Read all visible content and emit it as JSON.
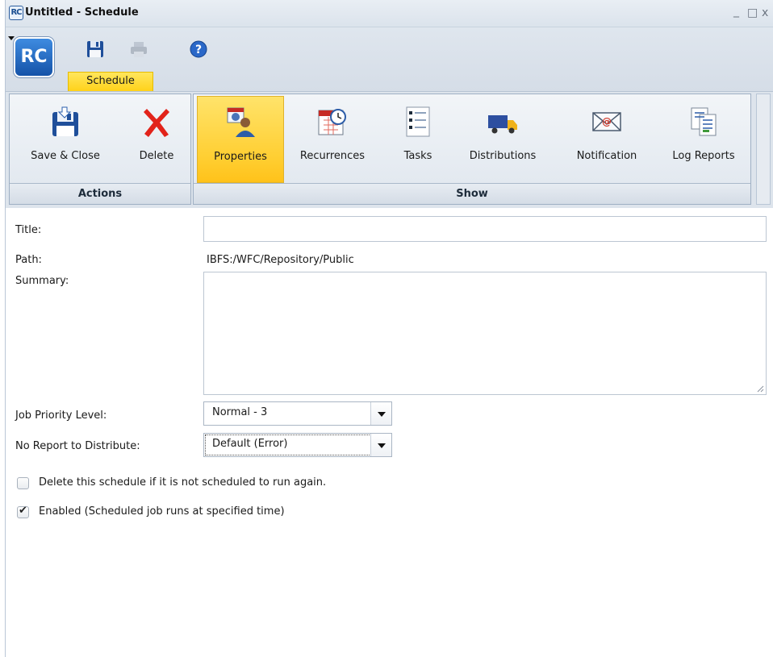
{
  "window": {
    "app_badge": "RC",
    "title": "Untitled - Schedule",
    "controls": {
      "minimize": "_",
      "maximize": "□",
      "close": "x"
    }
  },
  "quick_access": {
    "logo_text": "RC",
    "items": [
      {
        "name": "save",
        "icon": "floppy-disk-icon"
      },
      {
        "name": "print",
        "icon": "printer-icon",
        "disabled": true
      },
      {
        "name": "customize",
        "icon": "dropdown-arrow-icon"
      },
      {
        "name": "help",
        "icon": "help-icon"
      }
    ],
    "active_tab": "Schedule"
  },
  "ribbon": {
    "groups": [
      {
        "label": "Actions",
        "buttons": [
          {
            "label": "Save & Close",
            "icon": "save-close-icon"
          },
          {
            "label": "Delete",
            "icon": "delete-x-icon"
          }
        ]
      },
      {
        "label": "Show",
        "buttons": [
          {
            "label": "Properties",
            "icon": "properties-icon",
            "active": true
          },
          {
            "label": "Recurrences",
            "icon": "calendar-clock-icon"
          },
          {
            "label": "Tasks",
            "icon": "task-list-icon"
          },
          {
            "label": "Distributions",
            "icon": "truck-icon"
          },
          {
            "label": "Notification",
            "icon": "email-icon"
          },
          {
            "label": "Log Reports",
            "icon": "log-report-icon"
          }
        ]
      }
    ]
  },
  "form": {
    "title": {
      "label": "Title:",
      "value": ""
    },
    "path": {
      "label": "Path:",
      "value": "IBFS:/WFC/Repository/Public"
    },
    "summary": {
      "label": "Summary:",
      "value": ""
    },
    "job_priority": {
      "label": "Job Priority Level:",
      "value": "Normal - 3"
    },
    "no_report": {
      "label": "No Report to Distribute:",
      "value": "Default (Error)"
    },
    "delete_if_not_scheduled": {
      "label": "Delete this schedule if it is not scheduled to run again.",
      "checked": false
    },
    "enabled": {
      "label": "Enabled (Scheduled job runs at specified time)",
      "checked": true
    }
  },
  "colors": {
    "active_tab": "#ffd21a",
    "ribbon_bg": "#dde4ec",
    "logo_blue": "#1553a8",
    "delete_red": "#e2231a"
  }
}
